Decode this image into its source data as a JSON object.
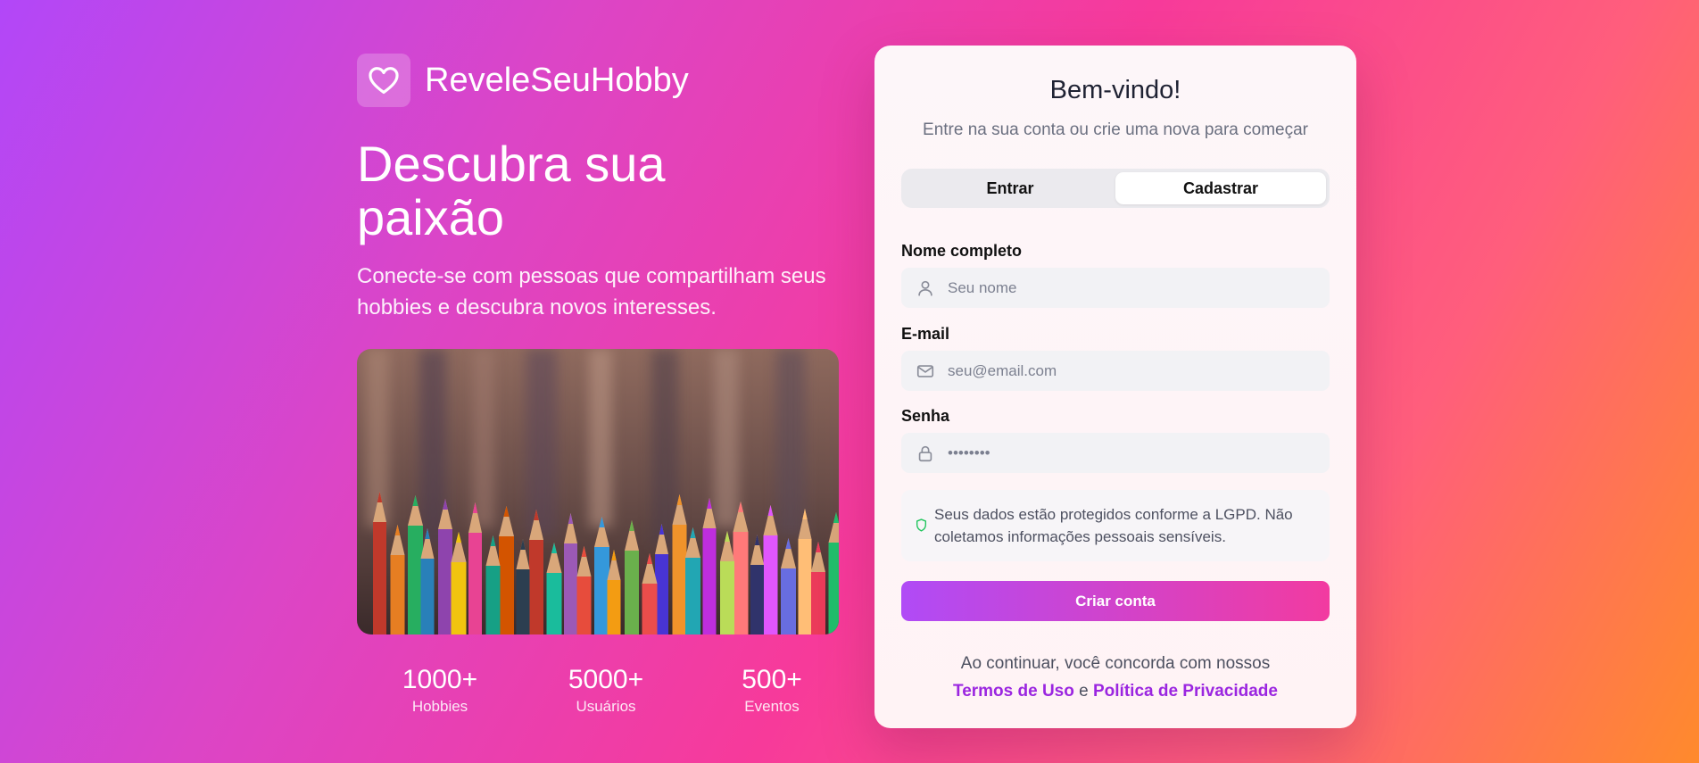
{
  "brand": {
    "name": "ReveleSeuHobby",
    "icon": "heart-icon"
  },
  "hero": {
    "title": "Descubra sua paixão",
    "subtitle": "Conecte-se com pessoas que compartilham seus hobbies e descubra novos interesses.",
    "image": "colored-pencils-photo"
  },
  "stats": [
    {
      "value": "1000+",
      "label": "Hobbies"
    },
    {
      "value": "5000+",
      "label": "Usuários"
    },
    {
      "value": "500+",
      "label": "Eventos"
    }
  ],
  "auth": {
    "title": "Bem-vindo!",
    "subtitle": "Entre na sua conta ou crie uma nova para começar",
    "tabs": [
      {
        "label": "Entrar",
        "active": false
      },
      {
        "label": "Cadastrar",
        "active": true
      }
    ],
    "fields": {
      "name": {
        "label": "Nome completo",
        "placeholder": "Seu nome",
        "value": "",
        "icon": "user-icon"
      },
      "email": {
        "label": "E-mail",
        "placeholder": "seu@email.com",
        "value": "",
        "icon": "mail-icon"
      },
      "password": {
        "label": "Senha",
        "placeholder": "••••••••",
        "value": "",
        "icon": "lock-icon"
      }
    },
    "privacy_notice": "Seus dados estão protegidos conforme a LGPD. Não coletamos informações pessoais sensíveis.",
    "submit_label": "Criar conta",
    "legal": {
      "prefix": "Ao continuar, você concorda com nossos",
      "terms": "Termos de Uso",
      "conjunction": "e",
      "privacy": "Política de Privacidade"
    }
  },
  "colors": {
    "accent_purple": "#9b26e0",
    "button_gradient_start": "#b04bf6",
    "button_gradient_end": "#f23ba0",
    "shield_green": "#22c55e"
  }
}
